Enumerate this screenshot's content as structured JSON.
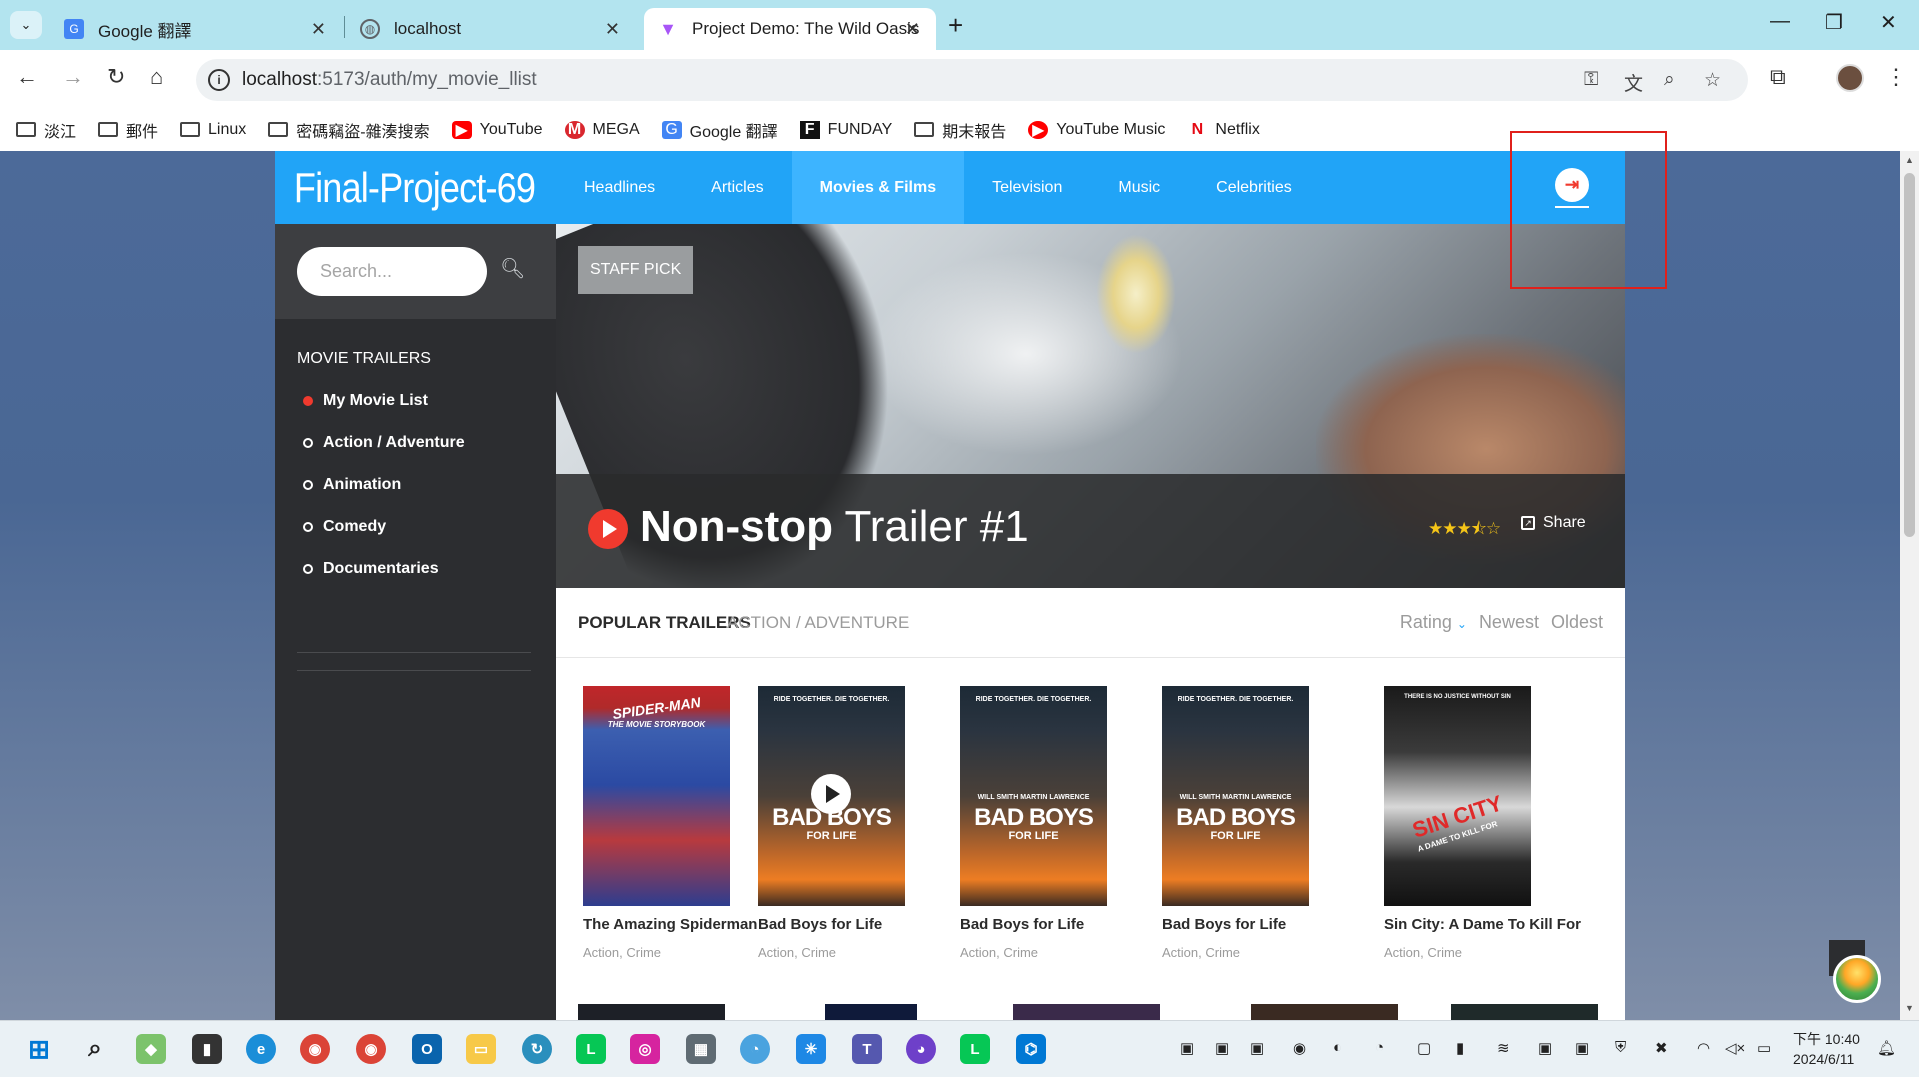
{
  "browser": {
    "tabs": [
      {
        "title": "Google 翻譯",
        "icon": "google-translate-icon"
      },
      {
        "title": "localhost",
        "icon": "globe-icon"
      },
      {
        "title": "Project Demo: The Wild Oasis",
        "icon": "vite-icon",
        "active": true
      }
    ],
    "url_host": "localhost",
    "url_path": ":5173/auth/my_movie_llist",
    "bookmarks": [
      {
        "label": "淡江",
        "icon": "folder-icon"
      },
      {
        "label": "郵件",
        "icon": "folder-icon"
      },
      {
        "label": "Linux",
        "icon": "folder-icon"
      },
      {
        "label": "密碼竊盜-雜湊搜索",
        "icon": "folder-icon"
      },
      {
        "label": "YouTube",
        "icon": "youtube-icon"
      },
      {
        "label": "MEGA",
        "icon": "mega-icon"
      },
      {
        "label": "Google 翻譯",
        "icon": "google-translate-icon"
      },
      {
        "label": "FUNDAY",
        "icon": "funday-icon"
      },
      {
        "label": "期末報告",
        "icon": "folder-icon"
      },
      {
        "label": "YouTube Music",
        "icon": "youtube-music-icon"
      },
      {
        "label": "Netflix",
        "icon": "netflix-icon"
      }
    ]
  },
  "site": {
    "logo": "Final-Project-69",
    "nav": [
      "Headlines",
      "Articles",
      "Movies & Films",
      "Television",
      "Music",
      "Celebrities"
    ],
    "active_nav": "Movies & Films",
    "search_placeholder": "Search...",
    "sidebar_title": "MOVIE TRAILERS",
    "sidebar_items": [
      "My Movie List",
      "Action / Adventure",
      "Animation",
      "Comedy",
      "Documentaries"
    ],
    "active_sidebar": "My Movie List",
    "hero": {
      "badge": "STAFF PICK",
      "title_bold": "Non-stop",
      "title_rest": "Trailer #1",
      "rating": 3.5,
      "rating_max": 5,
      "share_label": "Share"
    },
    "popular_label": "POPULAR TRAILERS",
    "popular_category": "ACTION / ADVENTURE",
    "sort_options": [
      "Rating",
      "Newest",
      "Oldest"
    ],
    "active_sort": "Rating",
    "movies": [
      {
        "title": "The Amazing Spiderman",
        "genre": "Action, Crime",
        "poster": "spider"
      },
      {
        "title": "Bad Boys for Life",
        "genre": "Action, Crime",
        "poster": "bad"
      },
      {
        "title": "Bad Boys for Life",
        "genre": "Action, Crime",
        "poster": "bad"
      },
      {
        "title": "Bad Boys for Life",
        "genre": "Action, Crime",
        "poster": "bad"
      },
      {
        "title": "Sin City: A Dame To Kill For",
        "genre": "Action, Crime",
        "poster": "sin"
      }
    ]
  },
  "taskbar": {
    "time": "下午 10:40",
    "date": "2024/6/11"
  },
  "colors": {
    "header_blue": "#21a4f7",
    "accent_red": "#f03a2e",
    "sidebar_dark": "#2c2d30",
    "highlight_box": "#e0201b"
  }
}
